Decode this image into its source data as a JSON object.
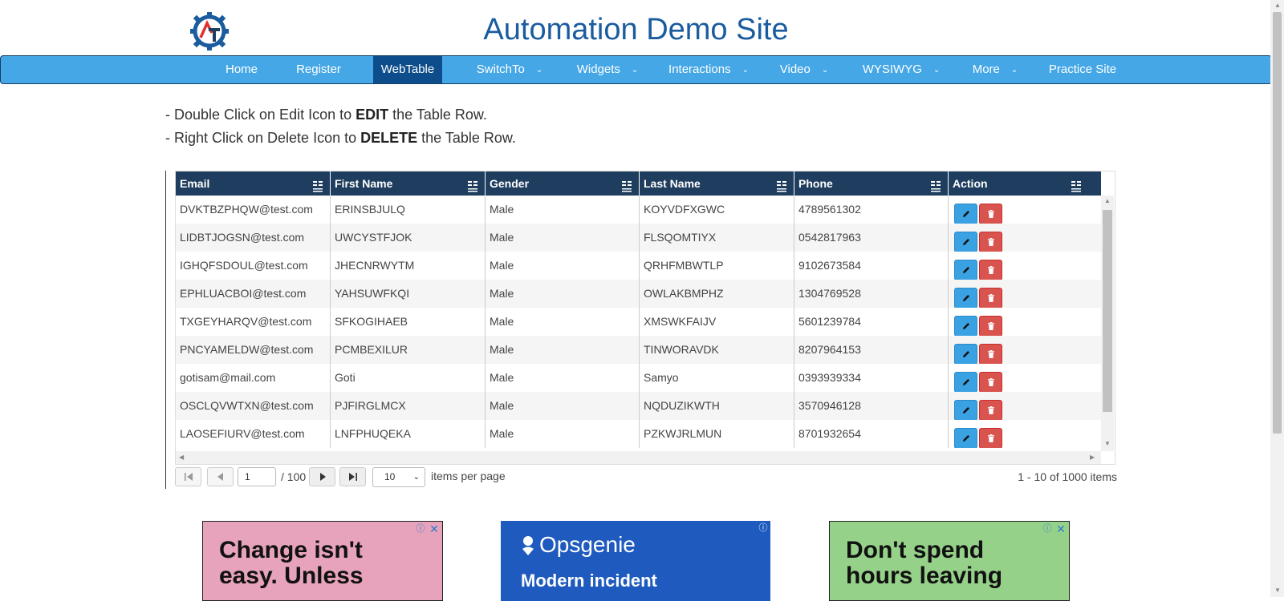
{
  "header": {
    "title": "Automation Demo Site"
  },
  "nav": {
    "items": [
      {
        "label": "Home",
        "dropdown": false
      },
      {
        "label": "Register",
        "dropdown": false
      },
      {
        "label": "WebTable",
        "dropdown": false,
        "active": true
      },
      {
        "label": "SwitchTo",
        "dropdown": true
      },
      {
        "label": "Widgets",
        "dropdown": true
      },
      {
        "label": "Interactions",
        "dropdown": true
      },
      {
        "label": "Video",
        "dropdown": true
      },
      {
        "label": "WYSIWYG",
        "dropdown": true
      },
      {
        "label": "More",
        "dropdown": true
      },
      {
        "label": "Practice Site",
        "dropdown": false
      }
    ]
  },
  "instructions": {
    "line1": {
      "prefix": "- Double Click on Edit Icon to ",
      "bold": "EDIT",
      "suffix": " the Table Row."
    },
    "line2": {
      "prefix": "- Right Click on Delete Icon to ",
      "bold": "DELETE",
      "suffix": " the Table Row."
    }
  },
  "table": {
    "columns": [
      "Email",
      "First Name",
      "Gender",
      "Last Name",
      "Phone",
      "Action"
    ],
    "rows": [
      [
        "DVKTBZPHQW@test.com",
        "ERINSBJULQ",
        "Male",
        "KOYVDFXGWC",
        "4789561302"
      ],
      [
        "LIDBTJOGSN@test.com",
        "UWCYSTFJOK",
        "Male",
        "FLSQOMTIYX",
        "0542817963"
      ],
      [
        "IGHQFSDOUL@test.com",
        "JHECNRWYTM",
        "Male",
        "QRHFMBWTLP",
        "9102673584"
      ],
      [
        "EPHLUACBOI@test.com",
        "YAHSUWFKQI",
        "Male",
        "OWLAKBMPHZ",
        "1304769528"
      ],
      [
        "TXGEYHARQV@test.com",
        "SFKOGIHAEB",
        "Male",
        "XMSWKFAIJV",
        "5601239784"
      ],
      [
        "PNCYAMELDW@test.com",
        "PCMBEXILUR",
        "Male",
        "TINWORAVDK",
        "8207964153"
      ],
      [
        "gotisam@mail.com",
        "Goti",
        "Male",
        "Samyo",
        "0393939334"
      ],
      [
        "OSCLQVWTXN@test.com",
        "PJFIRGLMCX",
        "Male",
        "NQDUZIKWTH",
        "3570946128"
      ],
      [
        "LAOSEFIURV@test.com",
        "LNFPHUQEKA",
        "Male",
        "PZKWJRLMUN",
        "8701932654"
      ]
    ]
  },
  "pager": {
    "page": "1",
    "total_pages": "/ 100",
    "page_size": "10",
    "per_page_label": "items per page",
    "info": "1 - 10 of 1000 items"
  },
  "ads": {
    "ad1": {
      "text_line1": "Change isn't",
      "text_line2": "easy. Unless"
    },
    "ad2": {
      "brand": "Opsgenie",
      "text": "Modern incident"
    },
    "ad3": {
      "text_line1": "Don't spend",
      "text_line2": "hours leaving"
    }
  },
  "colors": {
    "title": "#1a5c9e",
    "navbar": "#45a7e6",
    "nav_active": "#0d4d8c",
    "table_header": "#1f3d5e",
    "edit_button": "#3aa1e2",
    "delete_button": "#d9534f"
  }
}
